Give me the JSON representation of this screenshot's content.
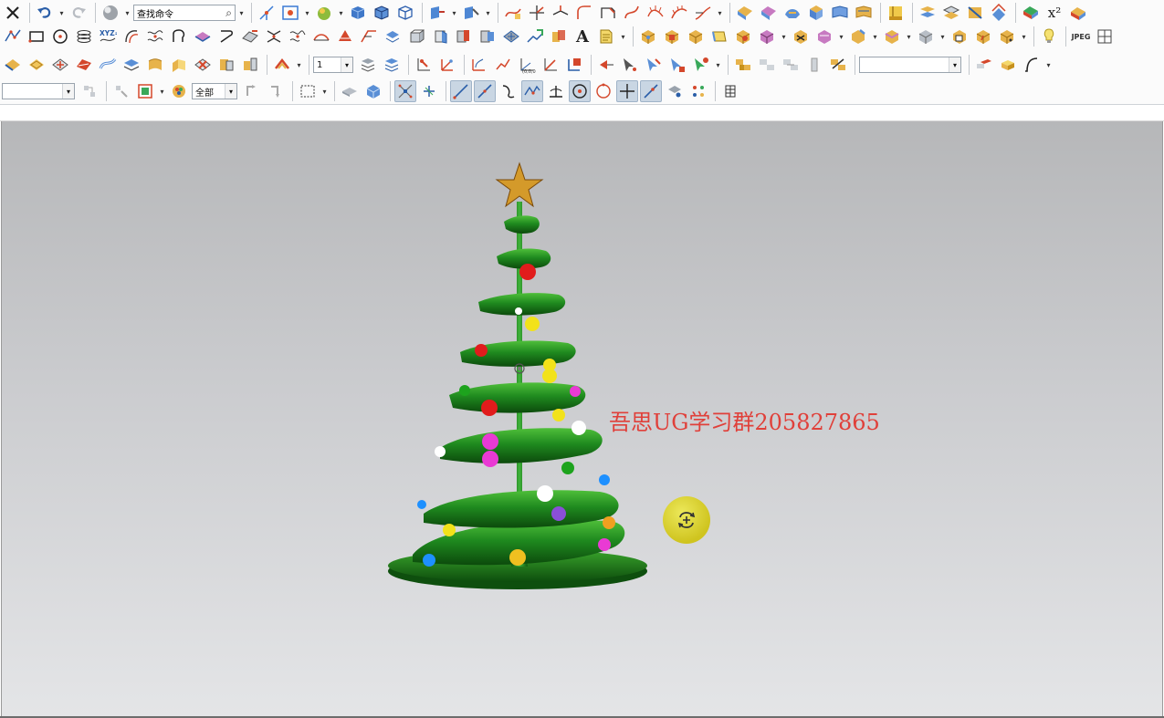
{
  "toolbar": {
    "find_command_text": "查找命令",
    "layer_select_value": "1",
    "filter_select_value": "",
    "scope_select_value": "全部",
    "text_tool_label": "A",
    "superscript_label": "x²",
    "jpeg_label": "JPEG",
    "style_select_value": "",
    "icons_row1": [
      "close-icon",
      "undo-icon",
      "redo-icon",
      "shaded-sphere-icon",
      "find-command-icon",
      "point-cloud-icon",
      "fit-view-icon",
      "render-style-icon",
      "shaded-cube-icon",
      "wireframe-cube-icon",
      "hidden-line-cube-icon",
      "view-orient-icon",
      "snap-view-icon",
      "sketch-curve-icon",
      "trim-curve-icon",
      "extend-curve-icon",
      "fillet-curve-icon",
      "offset-curve-icon",
      "bridge-curve-icon",
      "curve-analysis-icon",
      "surface-icon",
      "pattern-face-icon",
      "face-blend-icon",
      "reverse-icon",
      "sheet-icon",
      "hide-icon",
      "section-icon",
      "surface-blend-icon",
      "extend-sheet-icon",
      "trim-sheet-icon",
      "offset-face-icon",
      "superscript-icon",
      "color-map-icon"
    ],
    "icons_row2": [
      "line-icon",
      "rectangle-icon",
      "circle-center-icon",
      "helix-icon",
      "xyz-point-icon",
      "offset-icon",
      "wave-icon",
      "arc-icon",
      "shell-icon",
      "face-offset-icon",
      "surface-trim-icon",
      "divide-face-icon",
      "join-face-icon",
      "bridge-icon",
      "draft-icon",
      "shear-icon",
      "thicken-icon",
      "extrude-icon",
      "revolve-icon",
      "mesh-surface-icon",
      "measure-icon",
      "text-icon",
      "note-icon",
      "block-icon",
      "cylinder-icon",
      "cone-icon",
      "sphere-icon",
      "boolean-unite-icon",
      "boolean-subtract-icon",
      "boolean-intersect-icon",
      "mirror-body-icon",
      "chamfer-icon",
      "blend-icon",
      "draft-body-icon",
      "shell-body-icon",
      "hole-icon",
      "lightbulb-icon",
      "jpeg-export-icon",
      "grid-icon"
    ],
    "icons_row3": [
      "studio-surface-icon",
      "swept-icon",
      "through-curves-icon",
      "ruled-icon",
      "n-sided-icon",
      "law-extension-icon",
      "sheet-body-icon",
      "patch-icon",
      "trim-icon",
      "sew-icon",
      "unite-face-icon",
      "ribbon-icon",
      "layer-settings-icon",
      "work-layer-icon",
      "move-to-layer-icon",
      "datum-csys-icon",
      "datum-axis-icon",
      "datum-plane-icon",
      "point-set-icon",
      "vector-icon",
      "wcs-icon",
      "snap-point-icon",
      "select-face-icon",
      "select-edge-icon",
      "select-body-icon",
      "select-feature-icon",
      "assembly-icon",
      "component-icon",
      "constraint-icon",
      "mate-icon",
      "replace-icon",
      "block-render-icon",
      "box-icon",
      "spline-icon"
    ],
    "icons_row4": [
      "filter-icon",
      "feature-icon",
      "selection-icon",
      "color-wheel-icon",
      "class-select-icon",
      "deselect-icon",
      "rect-select-icon",
      "box-face-icon",
      "cube-small-icon",
      "snap-end-icon",
      "snap-mid-icon",
      "snap-line-icon",
      "snap-tangent-icon",
      "snap-curve-icon",
      "snap-intersection-icon",
      "snap-perp-icon",
      "snap-center-icon",
      "snap-quadrant-icon",
      "snap-existing-icon",
      "snap-on-curve-icon",
      "snap-face-icon",
      "snap-all-icon",
      "grid-settings-icon"
    ]
  },
  "viewport": {
    "watermark_text": "吾思UG学习群205827865",
    "watermark_color": "#e0403a",
    "background_top": "#b6b7b9",
    "background_bottom": "#e4e5e7",
    "model": "christmas-tree-spiral-model",
    "tree_color": "#1f8a1f",
    "star_color": "#d49a2a",
    "ornament_colors": [
      "#e11c1c",
      "#f2e21a",
      "#1da31d",
      "#e93ad4",
      "#ffffff",
      "#1e90ff",
      "#8a4fd8",
      "#f0a020"
    ],
    "cursor": "rotate-view-cursor"
  }
}
